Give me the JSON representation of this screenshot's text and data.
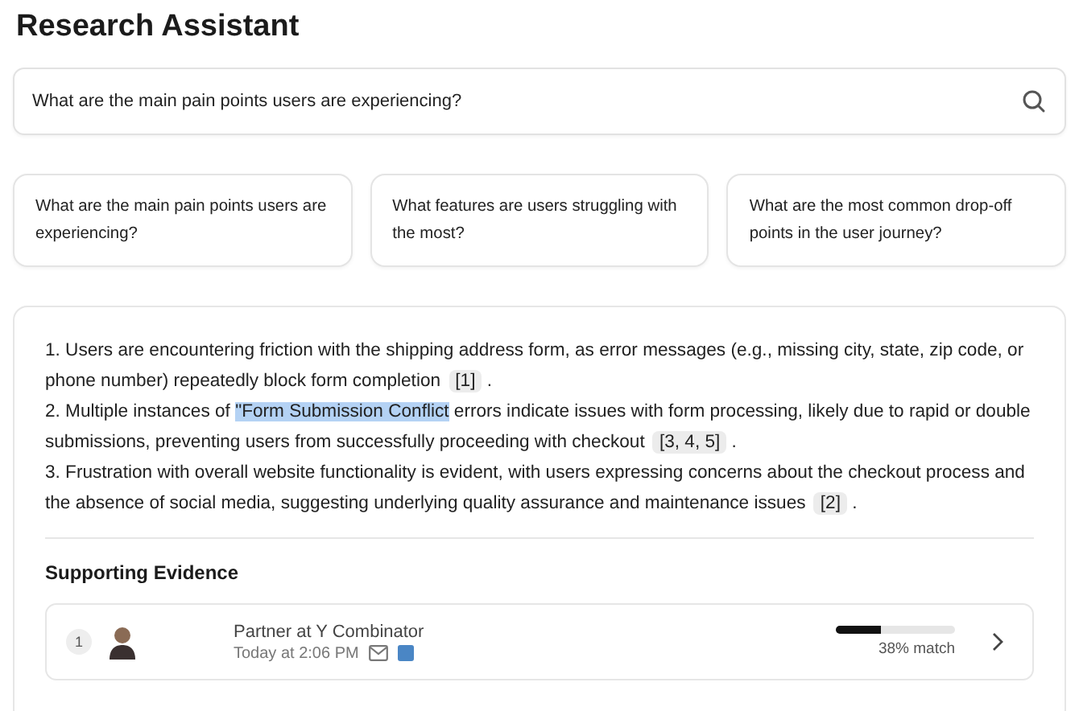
{
  "title": "Research Assistant",
  "search": {
    "value": "What are the main pain points users are experiencing?"
  },
  "suggestions": [
    "What are the main pain points users are experiencing?",
    "What features are users struggling with the most?",
    "What are the most common drop-off points in the user journey?"
  ],
  "answer": [
    {
      "segments": [
        {
          "text": "1. Users are encountering friction with the shipping address form, as error messages (e.g., missing city, state, zip code, or phone number) repeatedly block form completion",
          "selected": false
        }
      ],
      "citation": "[1]",
      "after": "."
    },
    {
      "segments": [
        {
          "text": "2. Multiple instances of ",
          "selected": false
        },
        {
          "text": "\"Form Submission Conflict",
          "selected": true
        },
        {
          "text": " errors indicate issues with form processing, likely due to rapid or double submissions, preventing users from successfully proceeding with checkout",
          "selected": false
        }
      ],
      "citation": "[3, 4, 5]",
      "after": "."
    },
    {
      "segments": [
        {
          "text": "3. Frustration with overall website functionality is evident, with users expressing concerns about the checkout process and the absence of social media, suggesting underlying quality assurance and maintenance issues",
          "selected": false
        }
      ],
      "citation": "[2]",
      "after": "."
    }
  ],
  "evidence": {
    "heading": "Supporting Evidence",
    "items": [
      {
        "index": "1",
        "role": "Partner at Y Combinator",
        "time": "Today at 2:06 PM",
        "level": 0.38,
        "match": "38% match"
      }
    ]
  }
}
